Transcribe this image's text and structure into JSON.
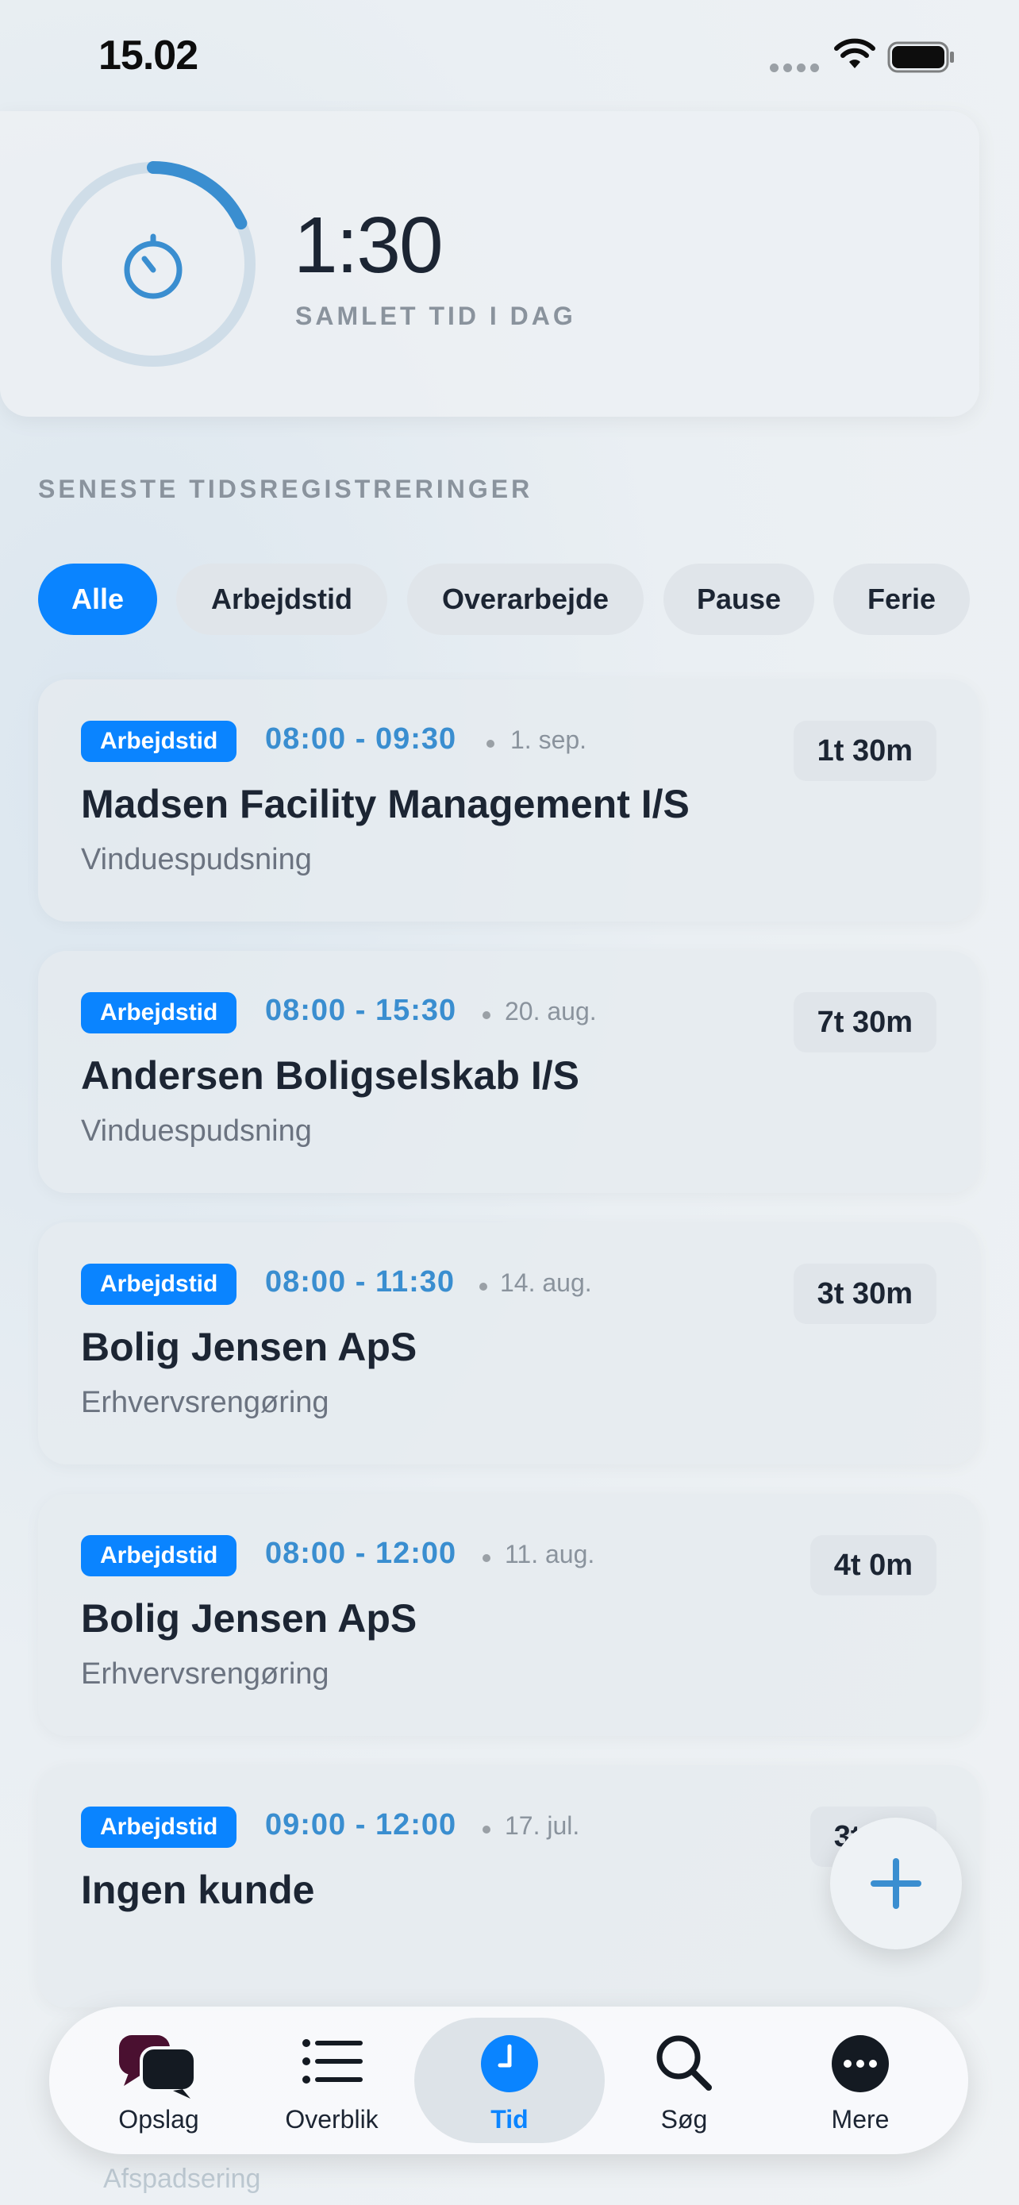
{
  "status_bar": {
    "time": "15.02"
  },
  "summary": {
    "total_time": "1:30",
    "total_label": "SAMLET TID I DAG",
    "ring_progress": 0.18
  },
  "section_title": "SENESTE TIDSREGISTRERINGER",
  "filters": [
    {
      "label": "Alle",
      "active": true
    },
    {
      "label": "Arbejdstid",
      "active": false
    },
    {
      "label": "Overarbejde",
      "active": false
    },
    {
      "label": "Pause",
      "active": false
    },
    {
      "label": "Ferie",
      "active": false
    }
  ],
  "entries": [
    {
      "type": "Arbejdstid",
      "time": "08:00 - 09:30",
      "date": "1. sep.",
      "customer": "Madsen Facility Management I/S",
      "task": "Vinduespudsning",
      "duration": "1t 30m"
    },
    {
      "type": "Arbejdstid",
      "time": "08:00 - 15:30",
      "date": "20. aug.",
      "customer": "Andersen Boligselskab I/S",
      "task": "Vinduespudsning",
      "duration": "7t 30m"
    },
    {
      "type": "Arbejdstid",
      "time": "08:00 - 11:30",
      "date": "14. aug.",
      "customer": "Bolig Jensen ApS",
      "task": "Erhvervsrengøring",
      "duration": "3t 30m"
    },
    {
      "type": "Arbejdstid",
      "time": "08:00 - 12:00",
      "date": "11. aug.",
      "customer": "Bolig Jensen ApS",
      "task": "Erhvervsrengøring",
      "duration": "4t 0m"
    },
    {
      "type": "Arbejdstid",
      "time": "09:00 - 12:00",
      "date": "17. jul.",
      "customer": "Ingen kunde",
      "task": "",
      "duration": "3t 0m"
    }
  ],
  "ghost_text": "Afspadsering",
  "tabs": [
    {
      "label": "Opslag",
      "icon": "chat-bubbles-icon",
      "active": false
    },
    {
      "label": "Overblik",
      "icon": "list-icon",
      "active": false
    },
    {
      "label": "Tid",
      "icon": "clock-icon",
      "active": true
    },
    {
      "label": "Søg",
      "icon": "search-icon",
      "active": false
    },
    {
      "label": "Mere",
      "icon": "more-icon",
      "active": false
    }
  ],
  "colors": {
    "accent": "#0a84ff",
    "time_text": "#3a8ed0",
    "ring_track": "#cfdde8",
    "ring_fill": "#3a8ed0"
  }
}
